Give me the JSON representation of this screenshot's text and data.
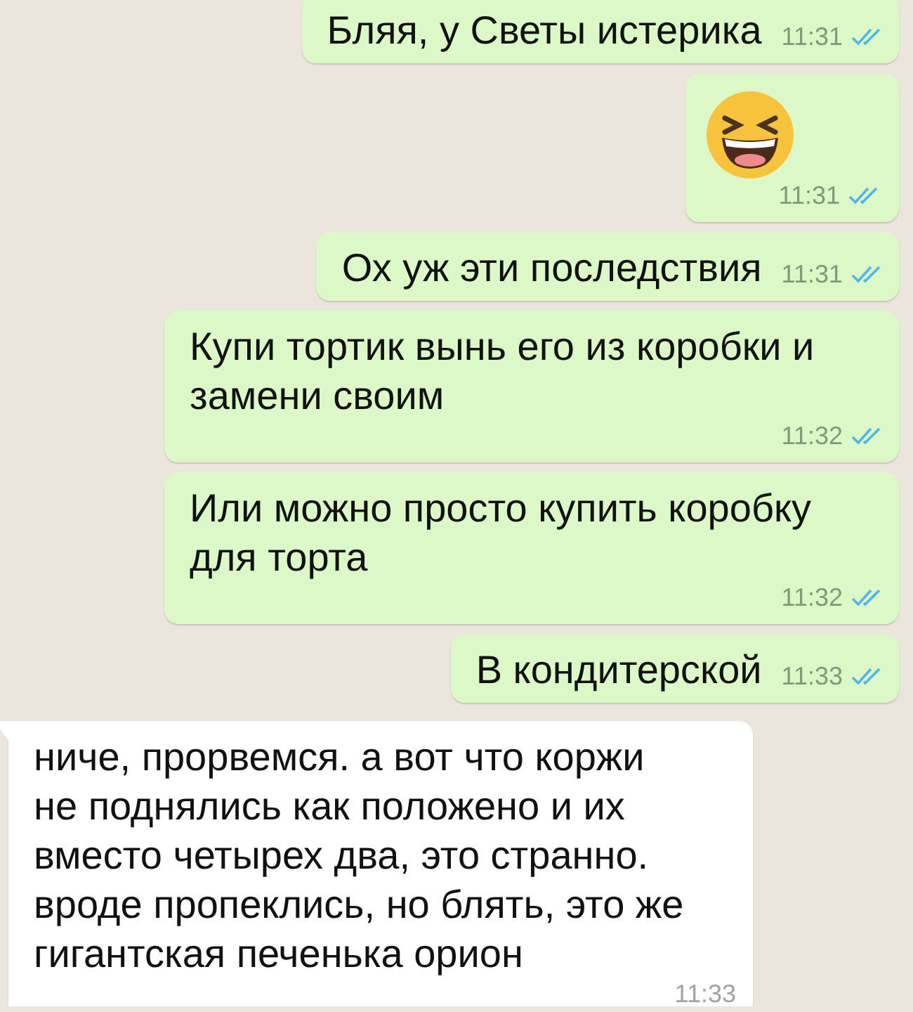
{
  "messages": [
    {
      "kind": "sent",
      "text": "Бляя, у Светы истерика",
      "time": "11:31",
      "read": true
    },
    {
      "kind": "emoji",
      "time": "11:31",
      "read": true
    },
    {
      "kind": "sent",
      "text": "Ох уж эти последствия",
      "time": "11:31",
      "read": true
    },
    {
      "kind": "sent",
      "text": "Купи тортик вынь его из коробки и замени своим",
      "time": "11:32",
      "read": true
    },
    {
      "kind": "sent",
      "text": "Или можно просто купить коробку для торта",
      "time": "11:32",
      "read": true
    },
    {
      "kind": "sent",
      "text": "В кондитерской",
      "time": "11:33",
      "read": true
    },
    {
      "kind": "received",
      "text": "ниче, прорвемся. а вот что коржи не поднялись как положено и их вместо четырех два, это странно. вроде пропеклись, но блять, это же гигантская печенька орион",
      "time": "11:33"
    }
  ]
}
